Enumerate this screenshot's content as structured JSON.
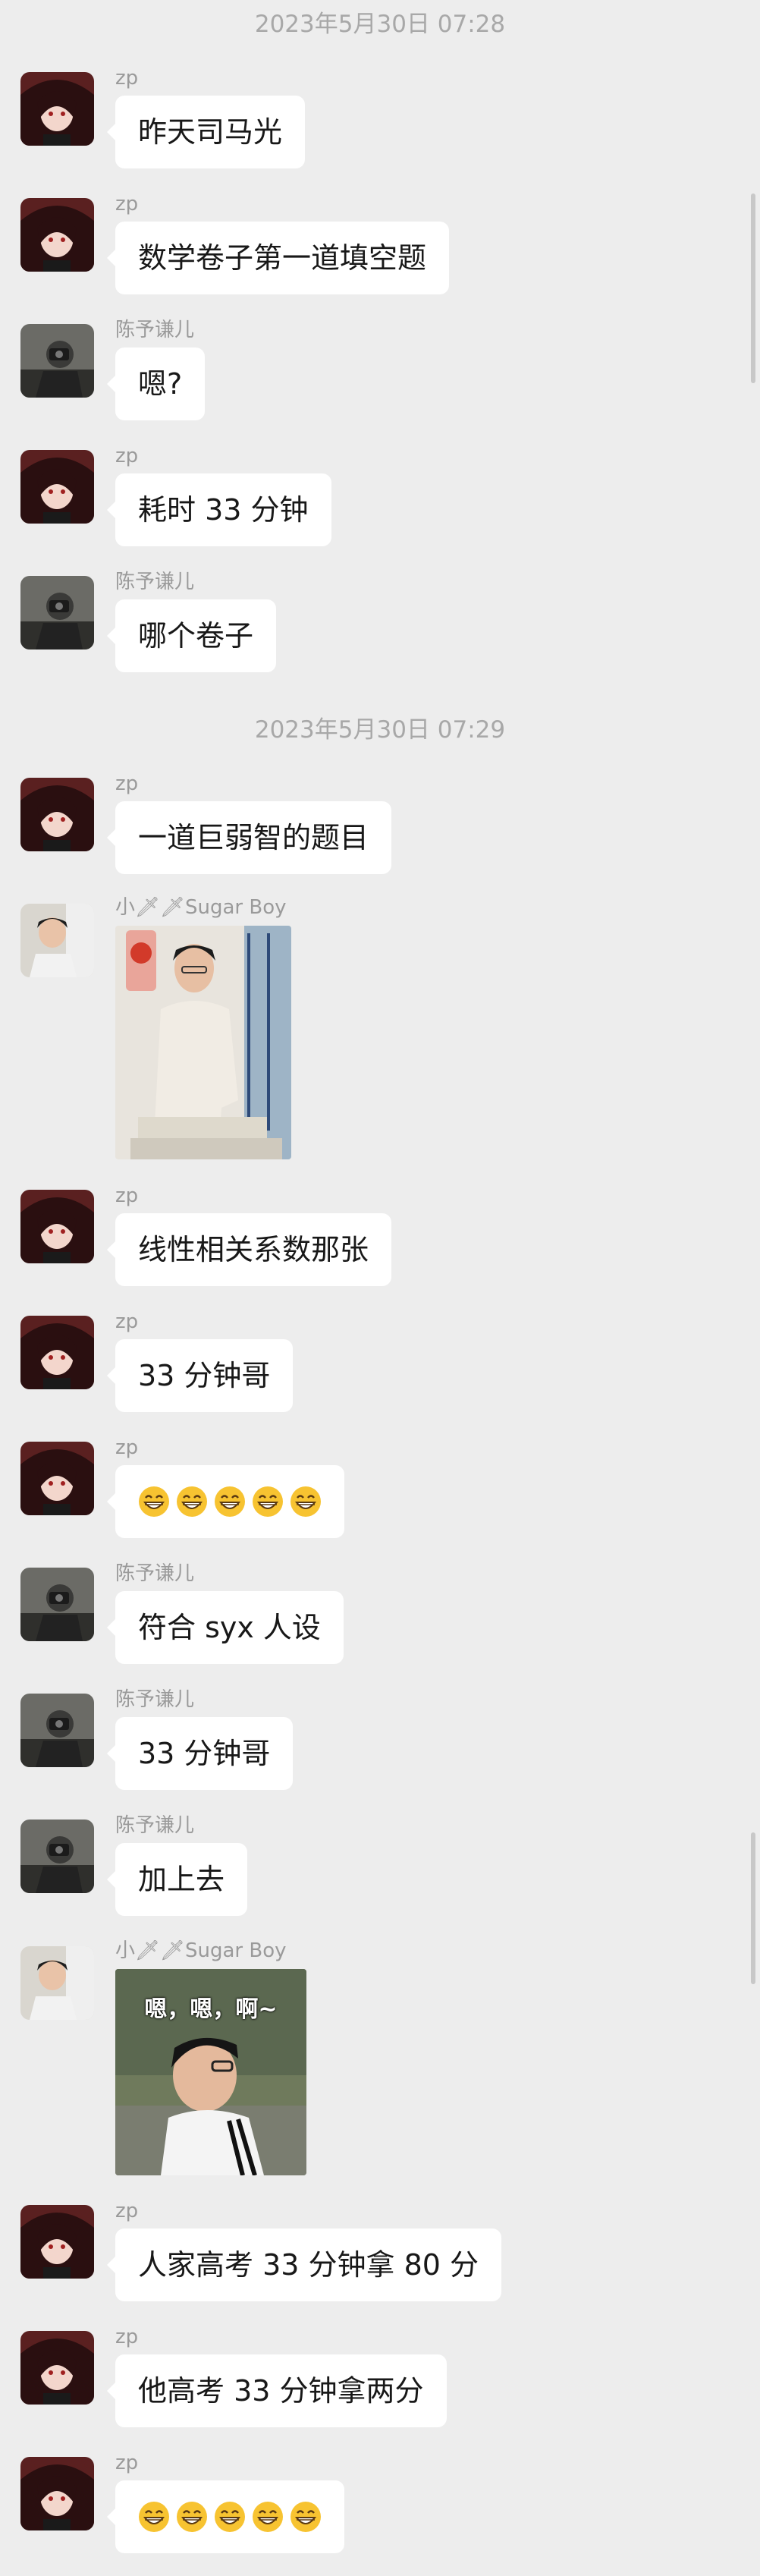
{
  "timestamps": [
    "2023年5月30日 07:28",
    "2023年5月30日 07:29"
  ],
  "senders": {
    "zp": "zp",
    "chen": "陈予谦儿",
    "sugar": "小🗡🗡Sugar Boy"
  },
  "messages": [
    {
      "sender": "zp",
      "text": "昨天司马光"
    },
    {
      "sender": "zp",
      "text": "数学卷子第一道填空题"
    },
    {
      "sender": "chen",
      "text": "嗯?"
    },
    {
      "sender": "zp",
      "text": "耗时 33 分钟"
    },
    {
      "sender": "chen",
      "text": "哪个卷子"
    },
    {
      "sender": "zp",
      "text": "一道巨弱智的题目"
    },
    {
      "sender": "sugar",
      "image": "photo-man-sitting"
    },
    {
      "sender": "zp",
      "text": "线性相关系数那张"
    },
    {
      "sender": "zp",
      "text": "33 分钟哥"
    },
    {
      "sender": "zp",
      "emoji": "grin-emoji",
      "emoji_count": 5
    },
    {
      "sender": "chen",
      "text": "符合 syx 人设"
    },
    {
      "sender": "chen",
      "text": "33 分钟哥"
    },
    {
      "sender": "chen",
      "text": "加上去"
    },
    {
      "sender": "sugar",
      "image": "sticker-boy-profile",
      "image_caption": "嗯，嗯，啊~"
    },
    {
      "sender": "zp",
      "text": "人家高考 33 分钟拿 80 分"
    },
    {
      "sender": "zp",
      "text": "他高考 33 分钟拿两分"
    },
    {
      "sender": "zp",
      "emoji": "grin-emoji",
      "emoji_count": 5
    }
  ],
  "colors": {
    "background": "#ededed",
    "bubble": "#ffffff",
    "timestamp": "#a8a8a8",
    "sender": "#9a9a9a"
  }
}
